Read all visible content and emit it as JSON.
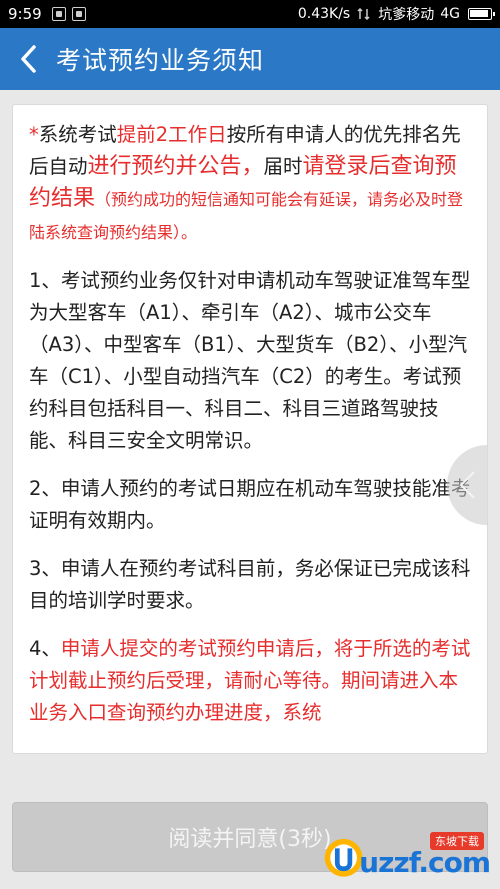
{
  "status_bar": {
    "time": "9:59",
    "network_speed": "0.43K/s",
    "carrier": "坑爹移动",
    "network_type": "4G"
  },
  "header": {
    "title": "考试预约业务须知",
    "back_icon": "chevron-left-icon"
  },
  "notice": {
    "intro": {
      "p1": "*",
      "p2": "系统考试",
      "p3": "提前2工作日",
      "p4": "按所有申请人的优先排名先后自动",
      "p5": "进行预约并公告，",
      "p6": "届时",
      "p7": "请登录后查询预约结果",
      "p8": "（预约成功的短信通知可能会有延误，请务必及时登陆系统查询预约结果）。"
    },
    "item1": "1、考试预约业务仅针对申请机动车驾驶证准驾车型为大型客车（A1）、牵引车（A2）、城市公交车（A3）、中型客车（B1）、大型货车（B2）、小型汽车（C1）、小型自动挡汽车（C2）的考生。考试预约科目包括科目一、科目二、科目三道路驾驶技能、科目三安全文明常识。",
    "item2": "2、申请人预约的考试日期应在机动车驾驶技能准考证明有效期内。",
    "item3": "3、申请人在预约考试科目前，务必保证已完成该科目的培训学时要求。",
    "item4": {
      "prefix": "4、",
      "text": "申请人提交的考试预约申请后，将于所选的考试计划截止预约后受理，请耐心等待。期间请进入本业务入口查询预约办理进度，系统"
    }
  },
  "agree_button": {
    "label": "阅读并同意(3秒)"
  },
  "watermark": {
    "text": "uzzf.com",
    "badge": "东坡下载"
  },
  "colors": {
    "header": "#2a78c6",
    "highlight": "#e62e2e",
    "button_disabled": "#c9c9c9"
  }
}
